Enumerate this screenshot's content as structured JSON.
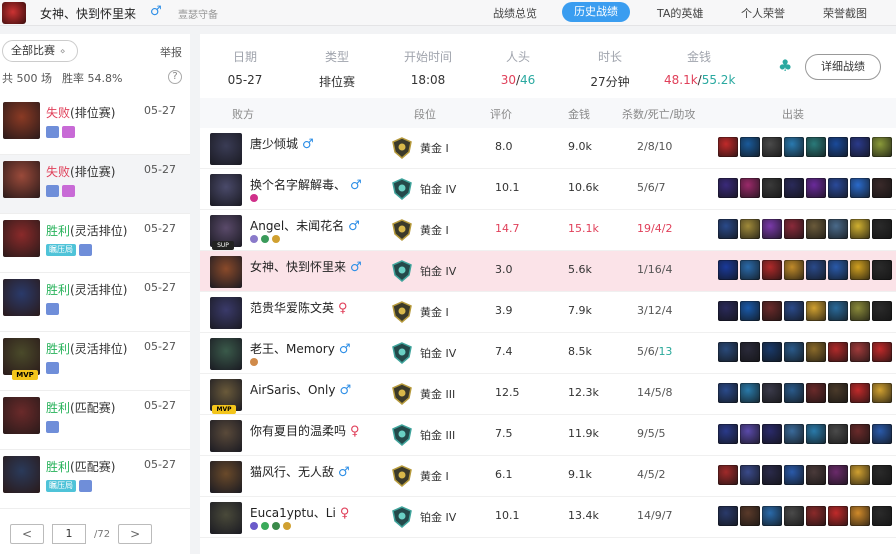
{
  "header": {
    "username": "女神、快到怀里来",
    "gender": "♂",
    "subtitle": "壹瑟守备",
    "tabs": [
      {
        "label": "战绩总览",
        "active": false
      },
      {
        "label": "历史战绩",
        "active": true
      },
      {
        "label": "TA的英雄",
        "active": false
      },
      {
        "label": "个人荣誉",
        "active": false
      },
      {
        "label": "荣誉截图",
        "active": false
      }
    ]
  },
  "left": {
    "filter_label": "全部比赛",
    "report_label": "举报",
    "total_label": "共 500 场",
    "winrate_label": "胜率 54.8%",
    "help": "?",
    "matches": [
      {
        "result": "失败",
        "mode": "(排位赛)",
        "date": "05-27",
        "kind": "lose",
        "badges": [
          "sq",
          "pink"
        ],
        "color": "#8a3a24"
      },
      {
        "result": "失败",
        "mode": "(排位赛)",
        "date": "05-27",
        "kind": "lose",
        "badges": [
          "sq",
          "pink"
        ],
        "color": "#9a4a3a"
      },
      {
        "result": "胜利",
        "mode": "(灵活排位)",
        "date": "05-27",
        "kind": "win",
        "badges": [
          "txt",
          "sq"
        ],
        "badge_text": "瞩压局",
        "color": "#8a2a2a"
      },
      {
        "result": "胜利",
        "mode": "(灵活排位)",
        "date": "05-27",
        "kind": "win",
        "badges": [
          "sq"
        ],
        "color": "#2a3a6a"
      },
      {
        "result": "胜利",
        "mode": "(灵活排位)",
        "date": "05-27",
        "kind": "win",
        "badges": [
          "sq"
        ],
        "mvp": "MVP",
        "color": "#4a4a2a"
      },
      {
        "result": "胜利",
        "mode": "(匹配赛)",
        "date": "05-27",
        "kind": "win",
        "badges": [
          "sq"
        ],
        "color": "#6a2a2a"
      },
      {
        "result": "胜利",
        "mode": "(匹配赛)",
        "date": "05-27",
        "kind": "win",
        "badges": [
          "txt",
          "sq"
        ],
        "badge_text": "瞩压局",
        "color": "#2a3a5a"
      }
    ],
    "pager": {
      "prev": "<",
      "page": "1",
      "total": "/72",
      "next": ">"
    }
  },
  "summary": {
    "date_label": "日期",
    "date": "05-27",
    "type_label": "类型",
    "type": "排位赛",
    "start_label": "开始时间",
    "start": "18:08",
    "kills_label": "人头",
    "kills_a": "30",
    "kills_b": "46",
    "duration_label": "时长",
    "duration": "27分钟",
    "gold_label": "金钱",
    "gold_a": "48.1k",
    "gold_b": "55.2k",
    "detail_button": "详细战绩"
  },
  "table": {
    "headers": {
      "team": "败方",
      "rank": "段位",
      "score": "评价",
      "gold": "金钱",
      "kda": "杀数/死亡/助攻",
      "items": "出装"
    },
    "rows": [
      {
        "name": "唐少倾城",
        "gender": "♂",
        "g": "m",
        "rank": "黄金 I",
        "tier": "gold",
        "score": "8.0",
        "gold": "9.0k",
        "k": "2",
        "d": "8",
        "a": "10",
        "champ": "#3a3c55",
        "tags": [],
        "items": [
          "#c02a2a",
          "#1a5a9a",
          "#4a4a4a",
          "#2a7ab0",
          "#2a7a7a",
          "#1a4a9a",
          "#2a3a8a",
          "#8a9a3a"
        ]
      },
      {
        "name": "换个名字解解毒、",
        "gender": "♂",
        "g": "m",
        "rank": "铂金 IV",
        "tier": "plat",
        "score": "10.1",
        "gold": "10.6k",
        "k": "5",
        "d": "6",
        "a": "7",
        "champ": "#4a4a6a",
        "tags": [
          "#d0308a"
        ],
        "items": [
          "#3a2a7a",
          "#9a2a6a",
          "#3a3a3a",
          "#2a2a5a",
          "#6a2a9a",
          "#2a4a9a",
          "#2a6aca",
          "#3a2a2a"
        ]
      },
      {
        "name": "Angel、未闻花名",
        "gender": "♂",
        "g": "m",
        "rank": "黄金 I",
        "tier": "gold",
        "score": "14.7",
        "gold": "15.1k",
        "k": "19",
        "d": "4",
        "a": "2",
        "red": true,
        "sup": "SUP",
        "champ": "#5a4a6a",
        "tags": [
          "#8a7aca",
          "#3a9a5a",
          "#d0a030"
        ],
        "items": [
          "#2a4a8a",
          "#a08a3a",
          "#7a3aaa",
          "#8a2a3a",
          "#6a5a3a",
          "#4a6a8a",
          "#d0b030",
          "#2a2a2a"
        ]
      },
      {
        "name": "女神、快到怀里来",
        "gender": "♂",
        "g": "m",
        "rank": "铂金 IV",
        "tier": "plat",
        "score": "3.0",
        "gold": "5.6k",
        "k": "1",
        "d": "16",
        "a": "4",
        "hl": true,
        "champ": "#8a4a2a",
        "tags": [],
        "items": [
          "#1a3a9a",
          "#2a6aaa",
          "#b02a2a",
          "#c08a2a",
          "#2a4a8a",
          "#2a5aaa",
          "#d0a020",
          "#2a2a2a"
        ]
      },
      {
        "name": "范贵华爱陈文英",
        "gender": "♀",
        "g": "f",
        "rank": "黄金 I",
        "tier": "gold",
        "score": "3.9",
        "gold": "7.9k",
        "k": "3",
        "d": "12",
        "a": "4",
        "champ": "#3a3a6a",
        "tags": [],
        "items": [
          "#2a2a5a",
          "#1a5aaa",
          "#6a2a2a",
          "#2a4a8a",
          "#d0a030",
          "#2a6a9a",
          "#8a8a3a",
          "#2a2a2a"
        ]
      },
      {
        "name": "老王、Memory",
        "gender": "♂",
        "g": "m",
        "rank": "铂金 IV",
        "tier": "plat",
        "score": "7.4",
        "gold": "8.5k",
        "k": "5",
        "d": "6",
        "a": "13",
        "asg": true,
        "champ": "#3a5a4a",
        "tags": [
          "#d08a4a"
        ],
        "items": [
          "#2a4a7a",
          "#2a2a3a",
          "#1a3a6a",
          "#2a5a8a",
          "#8a6a2a",
          "#b02a2a",
          "#a03a3a",
          "#c02a2a"
        ]
      },
      {
        "name": "AirSaris、Only",
        "gender": "♂",
        "g": "m",
        "rank": "黄金 III",
        "tier": "gold",
        "score": "12.5",
        "gold": "12.3k",
        "k": "14",
        "d": "5",
        "a": "8",
        "mvp": "MVP",
        "champ": "#6a5a3a",
        "tags": [],
        "items": [
          "#2a4a8a",
          "#2a7aaa",
          "#3a3a4a",
          "#2a5a8a",
          "#6a2a2a",
          "#4a3a2a",
          "#c02a2a",
          "#d0a030"
        ]
      },
      {
        "name": "你有夏目的温柔吗",
        "gender": "♀",
        "g": "f",
        "rank": "铂金 III",
        "tier": "plat",
        "score": "7.5",
        "gold": "11.9k",
        "k": "9",
        "d": "5",
        "a": "5",
        "champ": "#5a4a3a",
        "tags": [],
        "items": [
          "#2a3a8a",
          "#5a4aaa",
          "#2a2a6a",
          "#3a6a9a",
          "#2a7aaa",
          "#4a4a4a",
          "#6a2a2a",
          "#2a5aaa"
        ]
      },
      {
        "name": "猫风行、无人敌",
        "gender": "♂",
        "g": "m",
        "rank": "黄金 I",
        "tier": "gold",
        "score": "6.1",
        "gold": "9.1k",
        "k": "4",
        "d": "5",
        "a": "2",
        "champ": "#6a4a2a",
        "tags": [],
        "items": [
          "#a02a2a",
          "#3a4a8a",
          "#2a2a4a",
          "#2a5aaa",
          "#4a3a3a",
          "#6a2a6a",
          "#d0a030",
          "#2a2a2a"
        ]
      },
      {
        "name": "Euca1yptu、Li",
        "gender": "♀",
        "g": "f",
        "rank": "铂金 IV",
        "tier": "plat",
        "score": "10.1",
        "gold": "13.4k",
        "k": "14",
        "d": "9",
        "a": "7",
        "champ": "#4a4a3a",
        "tags": [
          "#6a5aca",
          "#3aaa5a",
          "#3a8a4a",
          "#d0a030"
        ],
        "items": [
          "#2a3a6a",
          "#5a3a2a",
          "#2a6aaa",
          "#4a4a4a",
          "#8a2a2a",
          "#c02a2a",
          "#d08a2a",
          "#2a2a2a"
        ]
      }
    ]
  }
}
